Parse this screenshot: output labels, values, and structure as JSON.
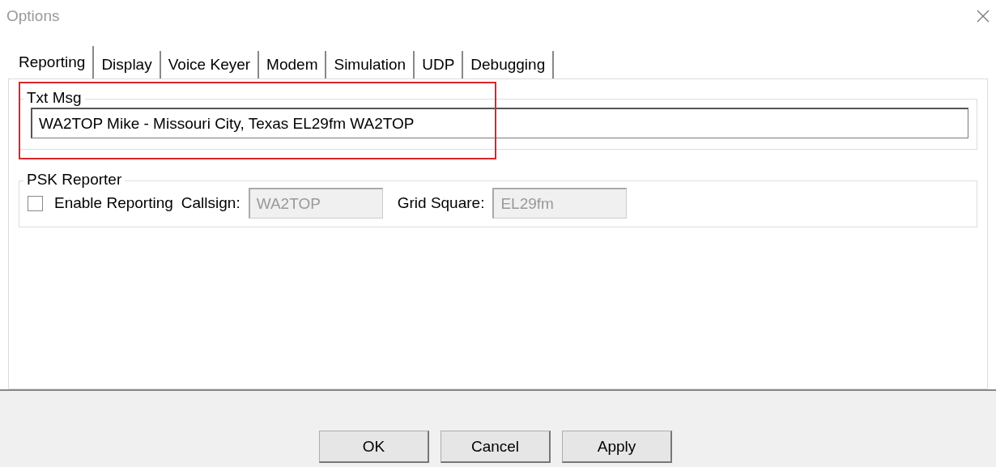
{
  "window": {
    "title": "Options"
  },
  "tabs": [
    {
      "label": "Reporting",
      "selected": true
    },
    {
      "label": "Display",
      "selected": false
    },
    {
      "label": "Voice Keyer",
      "selected": false
    },
    {
      "label": "Modem",
      "selected": false
    },
    {
      "label": "Simulation",
      "selected": false
    },
    {
      "label": "UDP",
      "selected": false
    },
    {
      "label": "Debugging",
      "selected": false
    }
  ],
  "txt_msg": {
    "label": "Txt Msg",
    "value": "WA2TOP Mike - Missouri City, Texas EL29fm WA2TOP"
  },
  "psk_reporter": {
    "label": "PSK Reporter",
    "enable_reporting": {
      "label": "Enable Reporting",
      "checked": false
    },
    "callsign": {
      "label": "Callsign:",
      "value": "WA2TOP",
      "disabled": true
    },
    "grid_square": {
      "label": "Grid Square:",
      "value": "EL29fm",
      "disabled": true
    }
  },
  "buttons": [
    "OK",
    "Cancel",
    "Apply"
  ]
}
